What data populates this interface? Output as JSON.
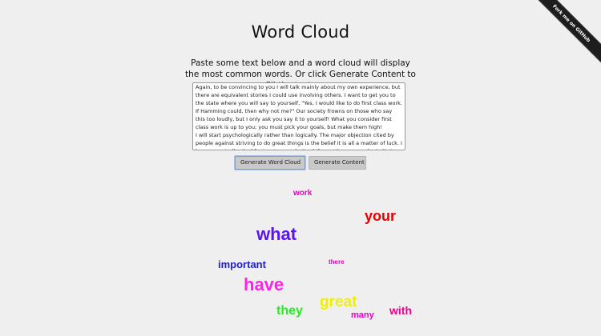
{
  "title": "Word Cloud",
  "intro": "Paste some text below and a word cloud will display the most common words. Or click Generate Content to fill the text area.",
  "textarea": {
    "value": "Again, to be convincing to you I will talk mainly about my own experience, but there are equivalent stories I could use involving others. I want to get you to the state where you will say to yourself, \"Yes, I would like to do first class work. If Hamming could, then why not me?\" Our society frowns on those who say this too loudly, but I only ask you say it to yourself! What you consider first class work is up to you; you must pick your goals, but make them high!\nI will start psychologically rather than logically. The major objection cited by people against striving to do great things is the belief it is all a matter of luck. I have repeatedly cited Pasteur's remark, \"Luck favors the prepared mind\". It"
  },
  "buttons": {
    "generate_cloud": "Generate Word Cloud",
    "generate_content": "Generate Content"
  },
  "ribbon": {
    "label": "Fork me on GitHub"
  },
  "cloud": {
    "words": [
      {
        "text": "work",
        "color": "#e600c8"
      },
      {
        "text": "your",
        "color": "#e60000"
      },
      {
        "text": "what",
        "color": "#5a14f0"
      },
      {
        "text": "important",
        "color": "#1e1ecc"
      },
      {
        "text": "there",
        "color": "#e600c8"
      },
      {
        "text": "have",
        "color": "#ff22e6"
      },
      {
        "text": "they",
        "color": "#22ee22"
      },
      {
        "text": "great",
        "color": "#f0f000"
      },
      {
        "text": "with",
        "color": "#e6008c"
      },
      {
        "text": "many",
        "color": "#e600c8"
      }
    ]
  }
}
